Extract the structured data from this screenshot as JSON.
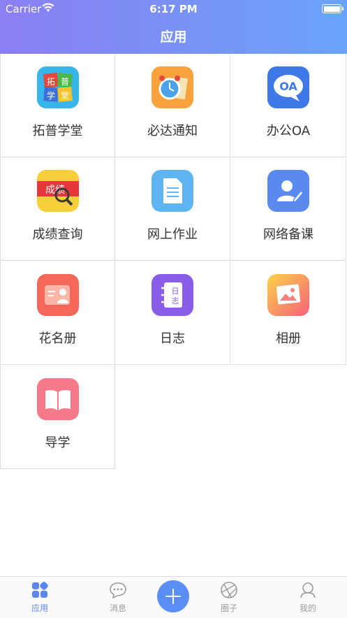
{
  "status_bar": {
    "carrier": "Carrier",
    "time": "6:17 PM"
  },
  "header": {
    "title": "应用"
  },
  "apps": [
    {
      "label": "拓普学堂",
      "icon": "tuopu-logo-icon"
    },
    {
      "label": "必达通知",
      "icon": "alarm-clock-icon"
    },
    {
      "label": "办公OA",
      "icon": "oa-bubble-icon",
      "icon_text": "OA"
    },
    {
      "label": "成绩查询",
      "icon": "grade-search-icon",
      "icon_text": "成绩"
    },
    {
      "label": "网上作业",
      "icon": "document-icon"
    },
    {
      "label": "网络备课",
      "icon": "user-edit-icon"
    },
    {
      "label": "花名册",
      "icon": "roster-icon"
    },
    {
      "label": "日志",
      "icon": "diary-icon",
      "icon_text": "日志"
    },
    {
      "label": "相册",
      "icon": "photo-album-icon"
    },
    {
      "label": "导学",
      "icon": "open-book-icon"
    }
  ],
  "tabbar": {
    "tabs": [
      {
        "label": "应用",
        "icon": "apps-grid-icon",
        "active": true
      },
      {
        "label": "消息",
        "icon": "chat-bubble-icon",
        "active": false
      },
      {
        "label": "",
        "icon": "plus-icon",
        "active": false
      },
      {
        "label": "圈子",
        "icon": "aperture-icon",
        "active": false
      },
      {
        "label": "我的",
        "icon": "person-icon",
        "active": false
      }
    ]
  },
  "colors": {
    "accent": "#5b86f0",
    "header_start": "#8b7ff3",
    "header_end": "#6aa3fb"
  }
}
